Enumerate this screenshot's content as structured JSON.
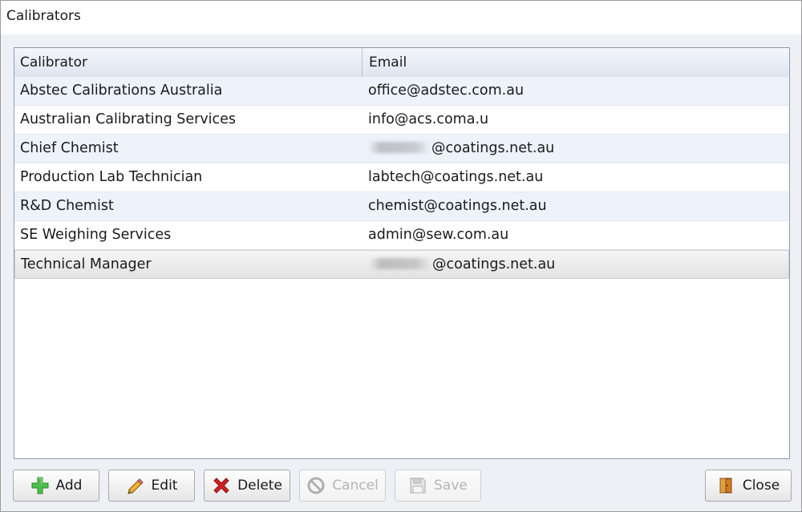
{
  "window": {
    "title": "Calibrators"
  },
  "grid": {
    "columns": [
      "Calibrator",
      "Email"
    ],
    "rows": [
      {
        "calibrator": "Abstec Calibrations Australia",
        "email": "office@adstec.com.au",
        "redacted": false
      },
      {
        "calibrator": "Australian Calibrating Services",
        "email": "info@acs.coma.u",
        "redacted": false
      },
      {
        "calibrator": "Chief Chemist",
        "email": "@coatings.net.au",
        "redacted": true
      },
      {
        "calibrator": "Production Lab Technician",
        "email": "labtech@coatings.net.au",
        "redacted": false
      },
      {
        "calibrator": "R&D Chemist",
        "email": "chemist@coatings.net.au",
        "redacted": false
      },
      {
        "calibrator": "SE Weighing Services",
        "email": "admin@sew.com.au",
        "redacted": false
      },
      {
        "calibrator": "Technical Manager",
        "email": "@coatings.net.au",
        "redacted": true
      }
    ],
    "selected_row": "Technical Manager"
  },
  "toolbar": {
    "add": {
      "label": "Add",
      "icon": "plus-icon",
      "enabled": true
    },
    "edit": {
      "label": "Edit",
      "icon": "pencil-icon",
      "enabled": true
    },
    "delete": {
      "label": "Delete",
      "icon": "red-x-icon",
      "enabled": true
    },
    "cancel": {
      "label": "Cancel",
      "icon": "cancel-circle-icon",
      "enabled": false
    },
    "save": {
      "label": "Save",
      "icon": "floppy-disk-icon",
      "enabled": false
    },
    "close": {
      "label": "Close",
      "icon": "door-exit-icon",
      "enabled": true
    }
  },
  "colors": {
    "alt_row": "#edf3fb",
    "header_bg": "#dde5f0",
    "delete_red": "#d42020",
    "add_green": "#3cb043"
  }
}
